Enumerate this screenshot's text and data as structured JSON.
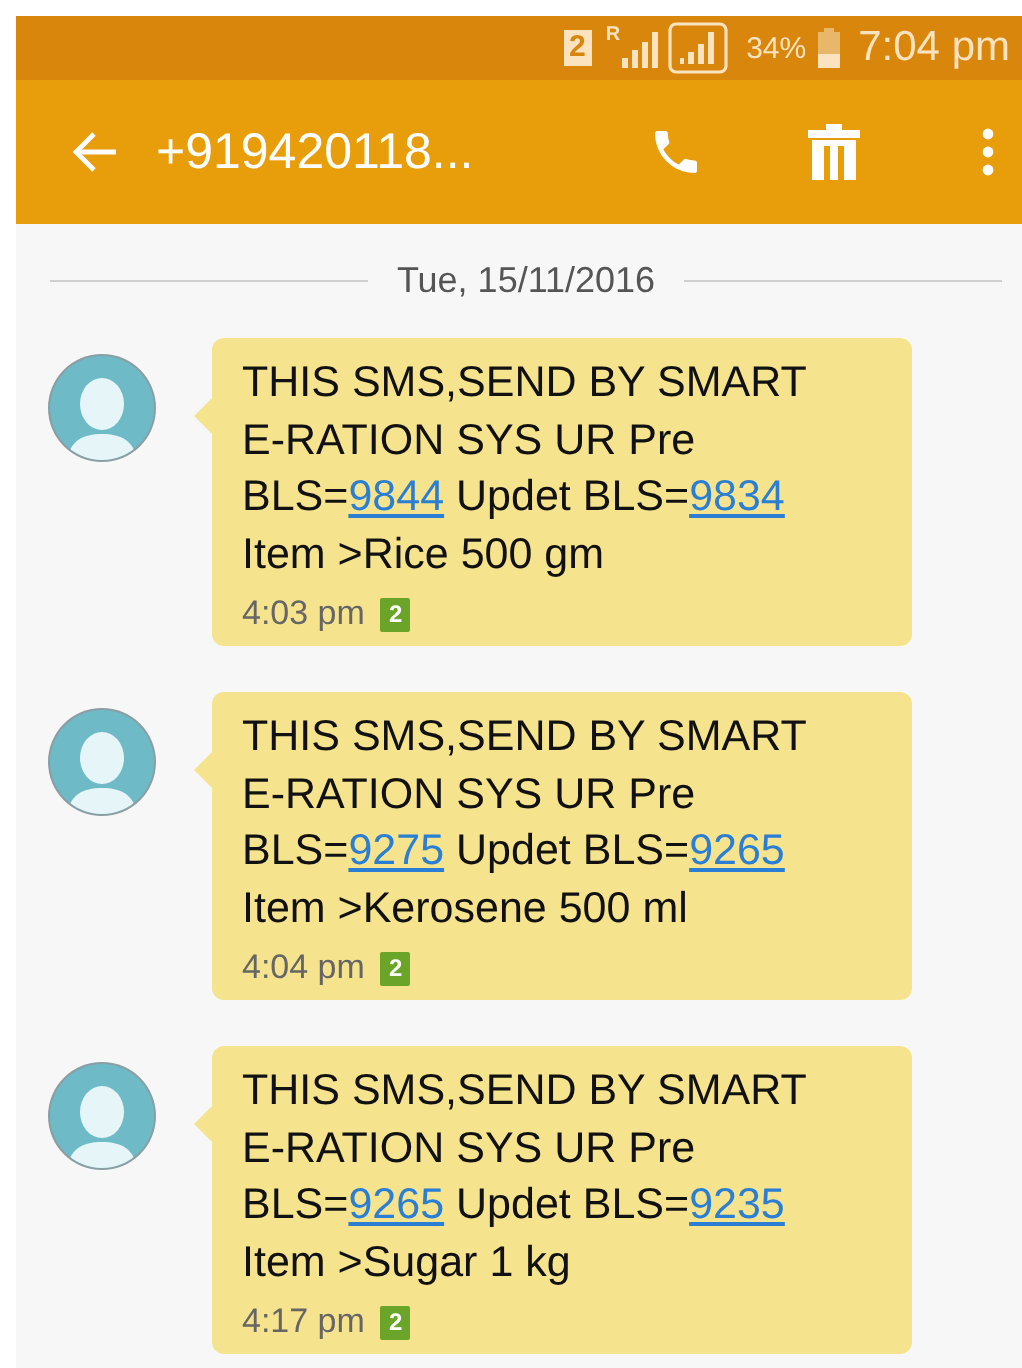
{
  "status_bar": {
    "sim": "2",
    "roaming": "R",
    "battery": "34%",
    "time": "7:04 pm"
  },
  "toolbar": {
    "title": "+919420118..."
  },
  "date_divider": "Tue, 15/11/2016",
  "messages": [
    {
      "segments": [
        {
          "kind": "text",
          "text": "THIS SMS,SEND BY SMART E-RATION SYS UR Pre BLS="
        },
        {
          "kind": "link",
          "text": "9844"
        },
        {
          "kind": "text",
          "text": " Updet BLS="
        },
        {
          "kind": "link",
          "text": "9834"
        },
        {
          "kind": "text",
          "text": " Item >Rice 500 gm"
        }
      ],
      "time": "4:03 pm",
      "sim": "2"
    },
    {
      "segments": [
        {
          "kind": "text",
          "text": "THIS SMS,SEND BY SMART E-RATION SYS UR Pre BLS="
        },
        {
          "kind": "link",
          "text": "9275"
        },
        {
          "kind": "text",
          "text": " Updet BLS="
        },
        {
          "kind": "link",
          "text": "9265"
        },
        {
          "kind": "text",
          "text": " Item >Kerosene 500 ml"
        }
      ],
      "time": "4:04 pm",
      "sim": "2"
    },
    {
      "segments": [
        {
          "kind": "text",
          "text": "THIS SMS,SEND BY SMART E-RATION SYS UR Pre BLS="
        },
        {
          "kind": "link",
          "text": "9265"
        },
        {
          "kind": "text",
          "text": " Updet BLS="
        },
        {
          "kind": "link",
          "text": "9235"
        },
        {
          "kind": "text",
          "text": " Item >Sugar 1 kg"
        }
      ],
      "time": "4:17 pm",
      "sim": "2"
    }
  ]
}
